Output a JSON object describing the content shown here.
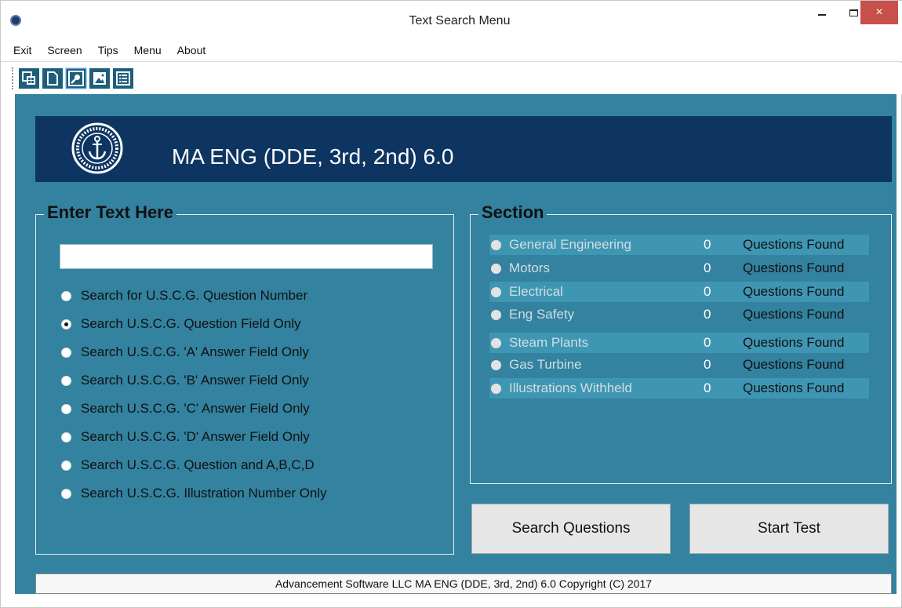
{
  "window": {
    "title": "Text Search Menu",
    "minimize_glyph": "minimize-icon",
    "maximize_glyph": "maximize-icon",
    "close_glyph": "×"
  },
  "menu": {
    "items": [
      "Exit",
      "Screen",
      "Tips",
      "Menu",
      "About"
    ]
  },
  "toolbar": {
    "buttons": [
      "database-icon",
      "document-icon",
      "search-icon",
      "image-icon",
      "list-icon"
    ],
    "active": "search-icon"
  },
  "banner": {
    "title": "MA ENG (DDE, 3rd, 2nd) 6.0",
    "logo": "anchor-logo"
  },
  "enter_text": {
    "title": "Enter Text Here",
    "input_value": "",
    "options": [
      {
        "label": "Search for U.S.C.G. Question Number",
        "checked": false
      },
      {
        "label": "Search U.S.C.G. Question Field Only",
        "checked": true
      },
      {
        "label": "Search U.S.C.G. 'A' Answer Field Only",
        "checked": false
      },
      {
        "label": "Search U.S.C.G. 'B' Answer Field Only",
        "checked": false
      },
      {
        "label": "Search U.S.C.G. 'C' Answer Field Only",
        "checked": false
      },
      {
        "label": "Search U.S.C.G. 'D' Answer Field Only",
        "checked": false
      },
      {
        "label": "Search U.S.C.G. Question and A,B,C,D",
        "checked": false
      },
      {
        "label": "Search U.S.C.G. Illustration Number Only",
        "checked": false
      }
    ]
  },
  "section": {
    "title": "Section",
    "rows": [
      {
        "label": "General Engineering",
        "count": "0",
        "found": "Questions Found"
      },
      {
        "label": "Motors",
        "count": "0",
        "found": "Questions Found"
      },
      {
        "label": "Electrical",
        "count": "0",
        "found": "Questions Found"
      },
      {
        "label": "Eng Safety",
        "count": "0",
        "found": "Questions Found"
      },
      {
        "label": "Steam Plants",
        "count": "0",
        "found": "Questions Found"
      },
      {
        "label": "Gas Turbine",
        "count": "0",
        "found": "Questions Found"
      },
      {
        "label": "Illustrations Withheld",
        "count": "0",
        "found": "Questions Found"
      }
    ]
  },
  "buttons": {
    "search": "Search Questions",
    "start": "Start Test"
  },
  "status": {
    "text": "Advancement Software LLC MA ENG (DDE, 3rd, 2nd) 6.0 Copyright (C) 2017"
  },
  "colors": {
    "client_bg": "#33829f",
    "banner_bg": "#0e3562",
    "close_button": "#c7504a"
  }
}
